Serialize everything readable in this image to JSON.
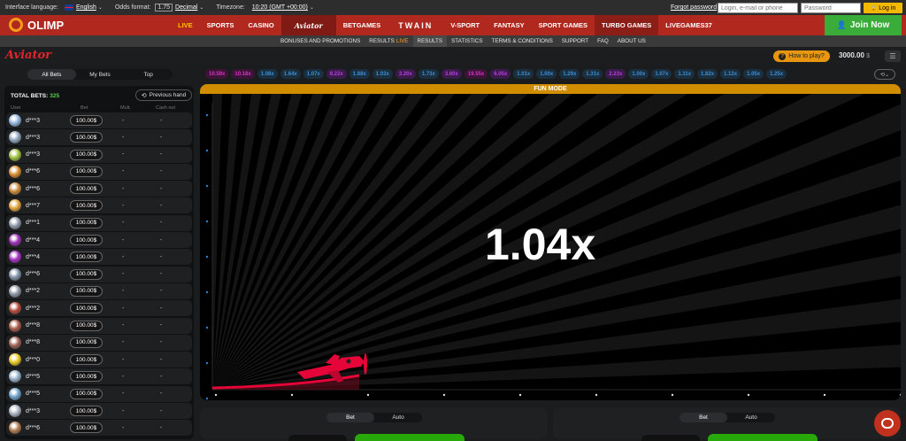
{
  "topbar": {
    "language_label": "Interface language:",
    "language_value": "English",
    "odds_label": "Odds format:",
    "odds_box": "1.75",
    "odds_value": "Decimal",
    "timezone_label": "Timezone:",
    "timezone_value": "10:20 (GMT +00:00)",
    "forgot_password": "Forgot password",
    "login_placeholder": "Login, e-mail or phone",
    "password_placeholder": "Password",
    "login_button": "Log in"
  },
  "brand": {
    "name": "OLIMP"
  },
  "nav": {
    "items": [
      "LIVE",
      "SPORTS",
      "CASINO",
      "Aviator",
      "BETGAMES",
      "TWAIN",
      "V-SPORT",
      "FANTASY",
      "SPORT GAMES",
      "TURBO GAMES",
      "LIVEGAMES37"
    ],
    "join_label": "Join Now"
  },
  "subnav": {
    "items": [
      "BONUSES AND PROMOTIONS",
      "RESULTS",
      "RESULTS",
      "STATISTICS",
      "TERMS & CONDITIONS",
      "SUPPORT",
      "FAQ",
      "ABOUT US"
    ],
    "live_tag": "LIVE"
  },
  "aviator": {
    "logo": "Aviator",
    "how_to_play": "How to play?",
    "balance": "3000.00",
    "currency": "$"
  },
  "bets_panel": {
    "tabs": [
      "All Bets",
      "My Bets",
      "Top"
    ],
    "total_label": "TOTAL BETS:",
    "total_count": "325",
    "previous_hand": "Previous hand",
    "columns": [
      "User",
      "Bet",
      "Mult.",
      "Cash out"
    ],
    "rows": [
      {
        "user": "d***3",
        "bet": "100.00$",
        "mult": "-",
        "cash": "-",
        "avatar": "#8fb3d9"
      },
      {
        "user": "d***3",
        "bet": "100.00$",
        "mult": "-",
        "cash": "-",
        "avatar": "#8fa3b9"
      },
      {
        "user": "d***3",
        "bet": "100.00$",
        "mult": "-",
        "cash": "-",
        "avatar": "#9bbf3a"
      },
      {
        "user": "d***6",
        "bet": "100.00$",
        "mult": "-",
        "cash": "-",
        "avatar": "#d88a2b"
      },
      {
        "user": "d***6",
        "bet": "100.00$",
        "mult": "-",
        "cash": "-",
        "avatar": "#c98a3a"
      },
      {
        "user": "d***7",
        "bet": "100.00$",
        "mult": "-",
        "cash": "-",
        "avatar": "#e0a13a"
      },
      {
        "user": "d***1",
        "bet": "100.00$",
        "mult": "-",
        "cash": "-",
        "avatar": "#8e98a8"
      },
      {
        "user": "d***4",
        "bet": "100.00$",
        "mult": "-",
        "cash": "-",
        "avatar": "#9a2fb5"
      },
      {
        "user": "d***4",
        "bet": "100.00$",
        "mult": "-",
        "cash": "-",
        "avatar": "#a42fc0"
      },
      {
        "user": "d***6",
        "bet": "100.00$",
        "mult": "-",
        "cash": "-",
        "avatar": "#7e8fa6"
      },
      {
        "user": "d***2",
        "bet": "100.00$",
        "mult": "-",
        "cash": "-",
        "avatar": "#8c93a0"
      },
      {
        "user": "d***2",
        "bet": "100.00$",
        "mult": "-",
        "cash": "-",
        "avatar": "#b34a3a"
      },
      {
        "user": "d***8",
        "bet": "100.00$",
        "mult": "-",
        "cash": "-",
        "avatar": "#a85a48"
      },
      {
        "user": "d***8",
        "bet": "100.00$",
        "mult": "-",
        "cash": "-",
        "avatar": "#9c6050"
      },
      {
        "user": "d***0",
        "bet": "100.00$",
        "mult": "-",
        "cash": "-",
        "avatar": "#e8c81f"
      },
      {
        "user": "d***5",
        "bet": "100.00$",
        "mult": "-",
        "cash": "-",
        "avatar": "#95b0c8"
      },
      {
        "user": "d***5",
        "bet": "100.00$",
        "mult": "-",
        "cash": "-",
        "avatar": "#6aa0c8"
      },
      {
        "user": "d***3",
        "bet": "100.00$",
        "mult": "-",
        "cash": "-",
        "avatar": "#a9b3bf"
      },
      {
        "user": "d***6",
        "bet": "100.00$",
        "mult": "-",
        "cash": "-",
        "avatar": "#b07a50"
      }
    ]
  },
  "history": {
    "badges": [
      {
        "v": "10.59x",
        "k": "hot"
      },
      {
        "v": "10.18x",
        "k": "hot"
      },
      {
        "v": "1.08x",
        "k": "blue"
      },
      {
        "v": "1.64x",
        "k": "blue"
      },
      {
        "v": "1.07x",
        "k": "blue"
      },
      {
        "v": "8.22x",
        "k": "purple"
      },
      {
        "v": "1.88x",
        "k": "blue"
      },
      {
        "v": "1.03x",
        "k": "blue"
      },
      {
        "v": "3.20x",
        "k": "purple"
      },
      {
        "v": "1.73x",
        "k": "blue"
      },
      {
        "v": "3.60x",
        "k": "purple"
      },
      {
        "v": "19.55x",
        "k": "hot"
      },
      {
        "v": "6.05x",
        "k": "purple"
      },
      {
        "v": "1.01x",
        "k": "blue"
      },
      {
        "v": "1.00x",
        "k": "blue"
      },
      {
        "v": "1.29x",
        "k": "blue"
      },
      {
        "v": "1.31x",
        "k": "blue"
      },
      {
        "v": "2.23x",
        "k": "purple"
      },
      {
        "v": "1.00x",
        "k": "blue"
      },
      {
        "v": "1.07x",
        "k": "blue"
      },
      {
        "v": "1.11x",
        "k": "blue"
      },
      {
        "v": "1.82x",
        "k": "blue"
      },
      {
        "v": "1.12x",
        "k": "blue"
      },
      {
        "v": "1.05x",
        "k": "blue"
      },
      {
        "v": "1.25x",
        "k": "blue"
      }
    ]
  },
  "game": {
    "mode_label": "FUN MODE",
    "multiplier": "1.04x",
    "plane_color": "#e50539"
  },
  "bet_controls": {
    "tabs": [
      "Bet",
      "Auto"
    ]
  },
  "colors": {
    "brand_red": "#b1281e",
    "accent_gold": "#d08d00",
    "join_green": "#3aac3a"
  }
}
